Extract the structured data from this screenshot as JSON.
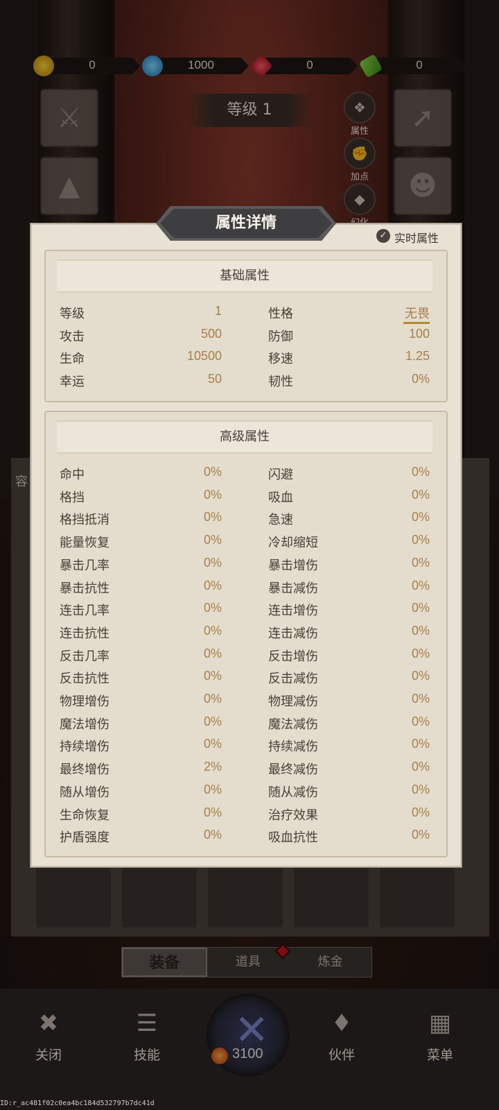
{
  "currency": [
    {
      "icon": "gold-coin-icon",
      "value": "0"
    },
    {
      "icon": "blue-gem-icon",
      "value": "1000"
    },
    {
      "icon": "red-ruby-icon",
      "value": "0"
    },
    {
      "icon": "green-ticket-icon",
      "value": "0"
    }
  ],
  "level_plate": "等级 1",
  "side_buttons": [
    {
      "label": "属性",
      "icon": "attribute-icon"
    },
    {
      "label": "加点",
      "icon": "fist-icon"
    },
    {
      "label": "幻化",
      "icon": "shirt-icon"
    }
  ],
  "panel": {
    "title": "属性详情",
    "realtime_label": "实时属性",
    "basic": {
      "header": "基础属性",
      "rows": [
        {
          "l1": "等级",
          "v1": "1",
          "l2": "性格",
          "v2": "无畏"
        },
        {
          "l1": "攻击",
          "v1": "500",
          "l2": "防御",
          "v2": "100"
        },
        {
          "l1": "生命",
          "v1": "10500",
          "l2": "移速",
          "v2": "1.25"
        },
        {
          "l1": "幸运",
          "v1": "50",
          "l2": "韧性",
          "v2": "0%"
        }
      ]
    },
    "advanced": {
      "header": "高级属性",
      "rows": [
        {
          "l1": "命中",
          "v1": "0%",
          "l2": "闪避",
          "v2": "0%"
        },
        {
          "l1": "格挡",
          "v1": "0%",
          "l2": "吸血",
          "v2": "0%"
        },
        {
          "l1": "格挡抵消",
          "v1": "0%",
          "l2": "急速",
          "v2": "0%"
        },
        {
          "l1": "能量恢复",
          "v1": "0%",
          "l2": "冷却缩短",
          "v2": "0%"
        },
        {
          "l1": "暴击几率",
          "v1": "0%",
          "l2": "暴击增伤",
          "v2": "0%"
        },
        {
          "l1": "暴击抗性",
          "v1": "0%",
          "l2": "暴击减伤",
          "v2": "0%"
        },
        {
          "l1": "连击几率",
          "v1": "0%",
          "l2": "连击增伤",
          "v2": "0%"
        },
        {
          "l1": "连击抗性",
          "v1": "0%",
          "l2": "连击减伤",
          "v2": "0%"
        },
        {
          "l1": "反击几率",
          "v1": "0%",
          "l2": "反击增伤",
          "v2": "0%"
        },
        {
          "l1": "反击抗性",
          "v1": "0%",
          "l2": "反击减伤",
          "v2": "0%"
        },
        {
          "l1": "物理增伤",
          "v1": "0%",
          "l2": "物理减伤",
          "v2": "0%"
        },
        {
          "l1": "魔法增伤",
          "v1": "0%",
          "l2": "魔法减伤",
          "v2": "0%"
        },
        {
          "l1": "持续增伤",
          "v1": "0%",
          "l2": "持续减伤",
          "v2": "0%"
        },
        {
          "l1": "最终增伤",
          "v1": "2%",
          "l2": "最终减伤",
          "v2": "0%"
        },
        {
          "l1": "随从增伤",
          "v1": "0%",
          "l2": "随从减伤",
          "v2": "0%"
        },
        {
          "l1": "生命恢复",
          "v1": "0%",
          "l2": "治疗效果",
          "v2": "0%"
        },
        {
          "l1": "护盾强度",
          "v1": "0%",
          "l2": "吸血抗性",
          "v2": "0%"
        }
      ]
    }
  },
  "bg_left_label": "容",
  "tabs": [
    "装备",
    "道具",
    "炼金"
  ],
  "nav": [
    {
      "label": "关闭",
      "icon": "close-hammer-icon"
    },
    {
      "label": "技能",
      "icon": "scroll-icon"
    },
    {
      "label": "伙伴",
      "icon": "wings-icon"
    },
    {
      "label": "菜单",
      "icon": "book-icon"
    }
  ],
  "energy": "3100",
  "device_id": "ID:r_ac481f02c0ea4bc184d532797b7dc41d"
}
